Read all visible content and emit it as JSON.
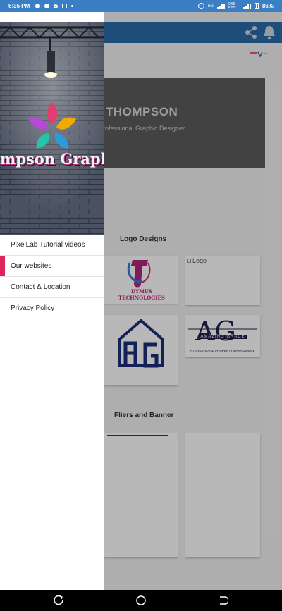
{
  "status_bar": {
    "time": "6:35 PM",
    "signal_text": "5G",
    "speed_text": "0.55 KB/s",
    "battery": "86%"
  },
  "background": {
    "hero": {
      "name": "THOMPSON",
      "role": "rofessional Graphic Designer"
    },
    "logo_section_title": "Logo Designs",
    "logo_cards": [
      {
        "alt": "",
        "caption": "DYMUS TECHNOLOGIES"
      },
      {
        "alt": "Logo",
        "caption": ""
      },
      {
        "alt": "",
        "caption": ""
      },
      {
        "alt": "",
        "caption": "AMAZING GRACE"
      }
    ],
    "ag_caption_sub": "INTERIORS AND PROPERTY MANAGEMENT",
    "fliers_section_title": "Fliers and Banner"
  },
  "drawer": {
    "header_text": "mpson Graphics De",
    "items": [
      {
        "label": "PixelLab Tutorial videos",
        "active": false
      },
      {
        "label": "Our websites",
        "active": true
      },
      {
        "label": "Contact & Location",
        "active": false
      },
      {
        "label": "Privacy Policy",
        "active": false
      }
    ]
  },
  "colors": {
    "status_bar": "#3a7ec4",
    "app_bar": "#2b6ba8",
    "active_indicator": "#e0245e",
    "hero_bg": "#5c5c5c"
  }
}
